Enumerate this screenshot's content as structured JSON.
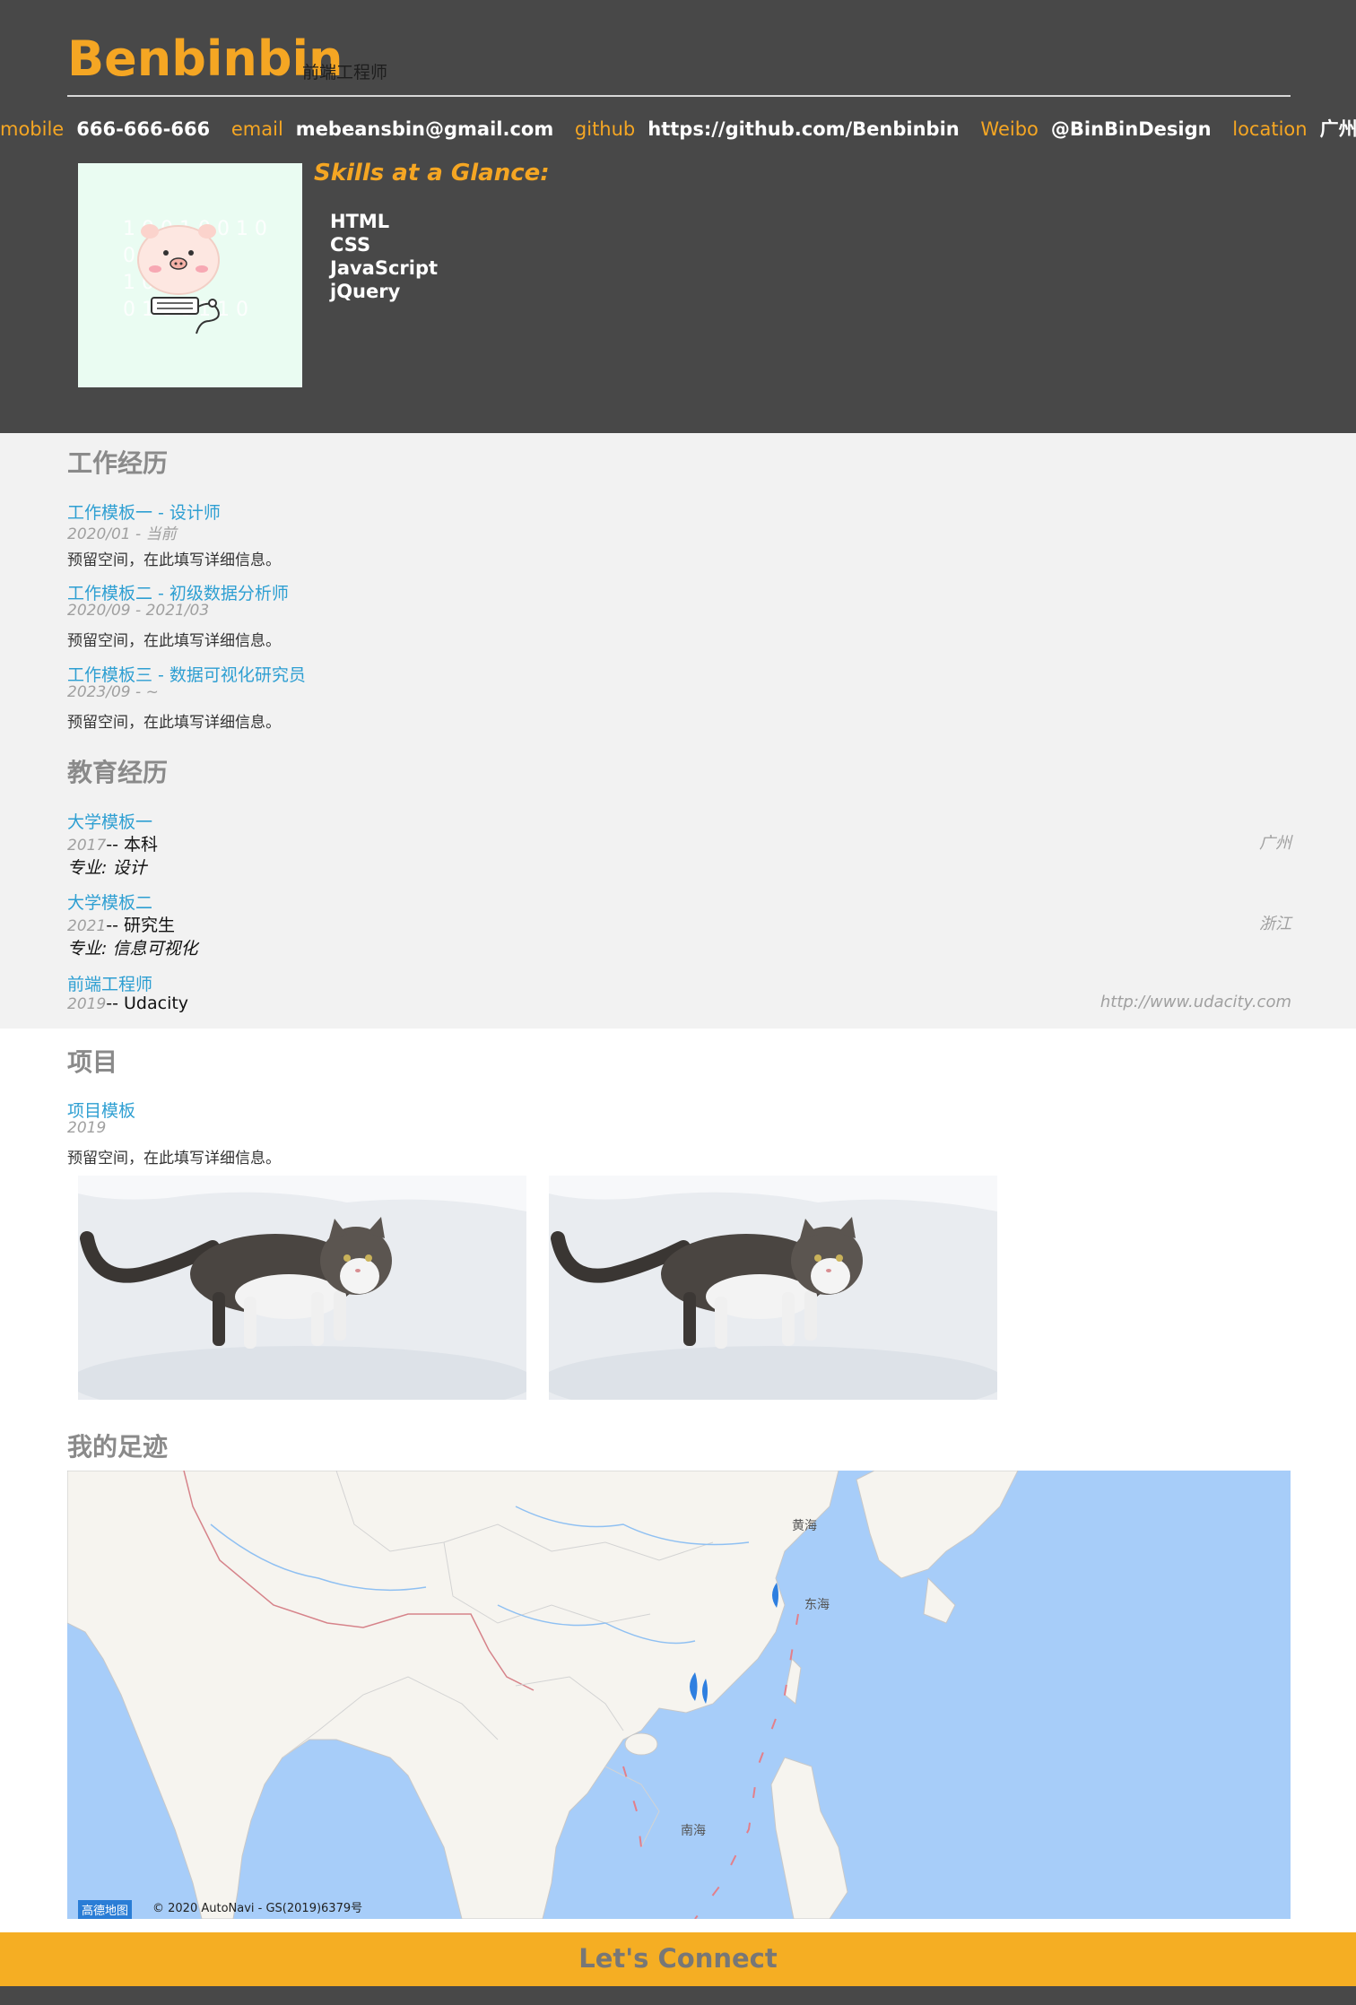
{
  "header": {
    "name": "Benbinbin",
    "role": "前端工程师",
    "contacts": [
      {
        "key": "mobile",
        "value": "666-666-666"
      },
      {
        "key": "email",
        "value": "mebeansbin@gmail.com"
      },
      {
        "key": "github",
        "value": "https://github.com/Benbinbin"
      },
      {
        "key": "Weibo",
        "value": "@BinBinDesign"
      },
      {
        "key": "location",
        "value": "广州"
      }
    ],
    "skills_title": "Skills at a Glance:",
    "skills": [
      "HTML",
      "CSS",
      "JavaScript",
      "jQuery"
    ]
  },
  "work": {
    "title": "工作经历",
    "items": [
      {
        "title": "工作模板一 - 设计师",
        "date": "2020/01 - 当前",
        "desc": "预留空间，在此填写详细信息。"
      },
      {
        "title": "工作模板二 - 初级数据分析师",
        "date": "2020/09 - 2021/03",
        "desc": "预留空间，在此填写详细信息。"
      },
      {
        "title": "工作模板三 - 数据可视化研究员",
        "date": "2023/09 - ~",
        "desc": "预留空间，在此填写详细信息。"
      }
    ]
  },
  "education": {
    "title": "教育经历",
    "items": [
      {
        "school": "大学模板一",
        "year": "2017",
        "degree": "-- 本科",
        "location": "广州",
        "major": "专业: 设计"
      },
      {
        "school": "大学模板二",
        "year": "2021",
        "degree": "-- 研究生",
        "location": "浙江",
        "major": "专业: 信息可视化"
      },
      {
        "school": "前端工程师",
        "year": "2019",
        "degree": "-- Udacity",
        "location": "http://www.udacity.com",
        "major": ""
      }
    ]
  },
  "projects": {
    "title": "项目",
    "items": [
      {
        "title": "项目模板",
        "date": "2019",
        "desc": "预留空间，在此填写详细信息。"
      }
    ]
  },
  "map": {
    "title": "我的足迹",
    "labels": {
      "yellow_sea": "黄海",
      "east_sea": "东海",
      "south_sea": "南海"
    },
    "credit": "© 2020 AutoNavi  - GS(2019)6379号",
    "logo": "高德地图"
  },
  "footer": {
    "title": "Let's Connect"
  },
  "colors": {
    "accent": "#f5a623",
    "header_bg": "#484848",
    "link": "#2e9fd2",
    "section_title": "#8a8a8a",
    "experience_bg": "#f2f2f2"
  }
}
